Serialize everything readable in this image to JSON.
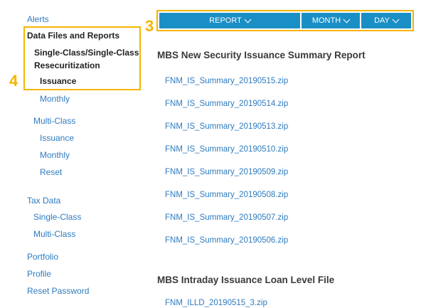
{
  "sidebar": {
    "alerts": "Alerts",
    "data_files": "Data Files and Reports",
    "single_class": "Single-Class/Single-Class Resecuritization",
    "sc_issuance": "Issuance",
    "sc_monthly": "Monthly",
    "multi_class": "Multi-Class",
    "mc_issuance": "Issuance",
    "mc_monthly": "Monthly",
    "mc_reset": "Reset",
    "tax_data": "Tax Data",
    "tax_single": "Single-Class",
    "tax_multi": "Multi-Class",
    "portfolio": "Portfolio",
    "profile": "Profile",
    "reset_password": "Reset Password"
  },
  "annotations": {
    "marker_3": "3",
    "marker_4": "4"
  },
  "toolbar": {
    "report": "REPORT",
    "month": "MONTH",
    "day": "DAY"
  },
  "main": {
    "section1_title": "MBS New Security Issuance Summary Report",
    "files": [
      "FNM_IS_Summary_20190515.zip",
      "FNM_IS_Summary_20190514.zip",
      "FNM_IS_Summary_20190513.zip",
      "FNM_IS_Summary_20190510.zip",
      "FNM_IS_Summary_20190509.zip",
      "FNM_IS_Summary_20190508.zip",
      "FNM_IS_Summary_20190507.zip",
      "FNM_IS_Summary_20190506.zip"
    ],
    "section2_title": "MBS Intraday Issuance Loan Level File",
    "section2_file": "FNM_ILLD_20190515_3.zip"
  },
  "colors": {
    "accent": "#1a8fc6",
    "link": "#2e7bbf",
    "highlight": "#f5b400"
  }
}
